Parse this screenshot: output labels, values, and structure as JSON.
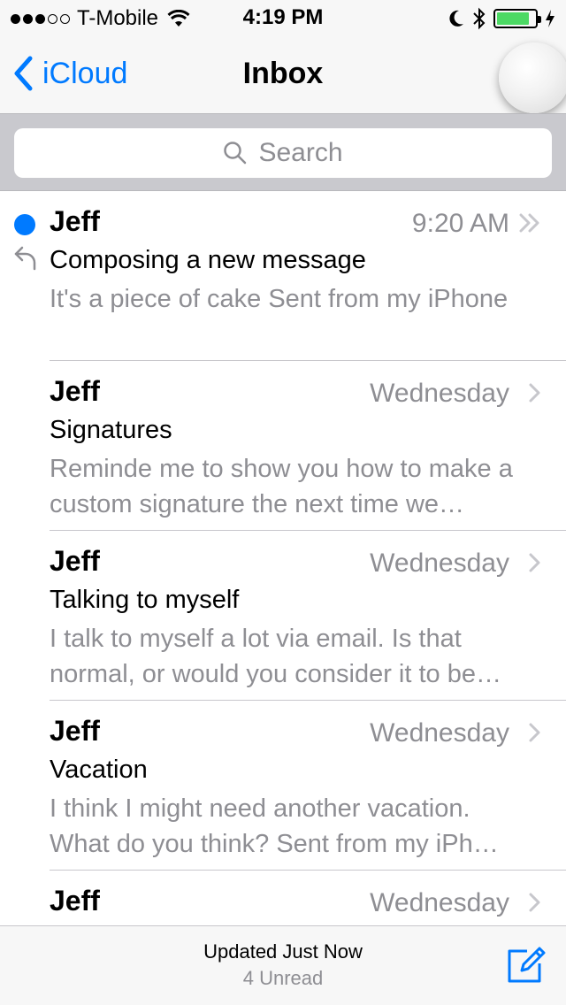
{
  "status_bar": {
    "carrier": "T-Mobile",
    "signal_bars_filled": 3,
    "signal_bars_total": 5,
    "time": "4:19 PM",
    "battery_color": "#4cd964",
    "battery_level": 0.85,
    "icons": [
      "wifi-icon",
      "moon-icon",
      "bluetooth-icon",
      "charging-bolt-icon"
    ]
  },
  "nav": {
    "back_label": "iCloud",
    "title": "Inbox",
    "accent": "#007aff"
  },
  "search": {
    "placeholder": "Search"
  },
  "messages": [
    {
      "sender": "Jeff",
      "date": "9:20 AM",
      "subject": "Composing a new message",
      "preview": "It's a piece of cake Sent from my iPhone",
      "unread": true,
      "replied": true,
      "thread": true
    },
    {
      "sender": "Jeff",
      "date": "Wednesday",
      "subject": "Signatures",
      "preview": "Reminde me to show you how to make a custom signature the next time we…",
      "unread": false,
      "replied": false,
      "thread": false
    },
    {
      "sender": "Jeff",
      "date": "Wednesday",
      "subject": "Talking to myself",
      "preview": "I talk to myself a lot via email. Is that normal, or would you consider it to be…",
      "unread": false,
      "replied": false,
      "thread": false
    },
    {
      "sender": "Jeff",
      "date": "Wednesday",
      "subject": "Vacation",
      "preview": "I think I might need another vacation. What do you think? Sent from my iPh…",
      "unread": false,
      "replied": false,
      "thread": false
    },
    {
      "sender": "Jeff",
      "date": "Wednesday",
      "subject": "",
      "preview": "",
      "unread": false,
      "replied": false,
      "thread": false
    }
  ],
  "toolbar": {
    "updated": "Updated Just Now",
    "unread": "4 Unread"
  }
}
